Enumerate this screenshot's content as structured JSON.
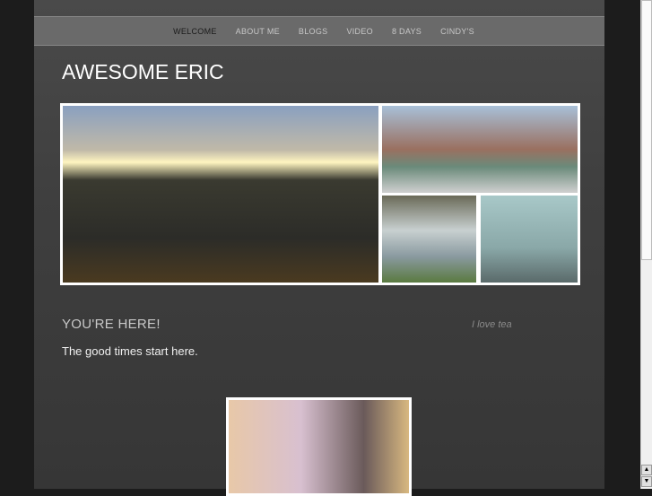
{
  "nav": {
    "items": [
      "WELCOME",
      "ABOUT ME",
      "BLOGS",
      "VIDEO",
      "8 DAYS",
      "CINDY'S"
    ],
    "active": "WELCOME"
  },
  "site_title": "AWESOME ERIC",
  "section": {
    "heading": "YOU'RE HERE!",
    "aside": "I love tea",
    "body": "The good times start here."
  },
  "scrollbar": {
    "up": "▲",
    "down": "▼"
  }
}
